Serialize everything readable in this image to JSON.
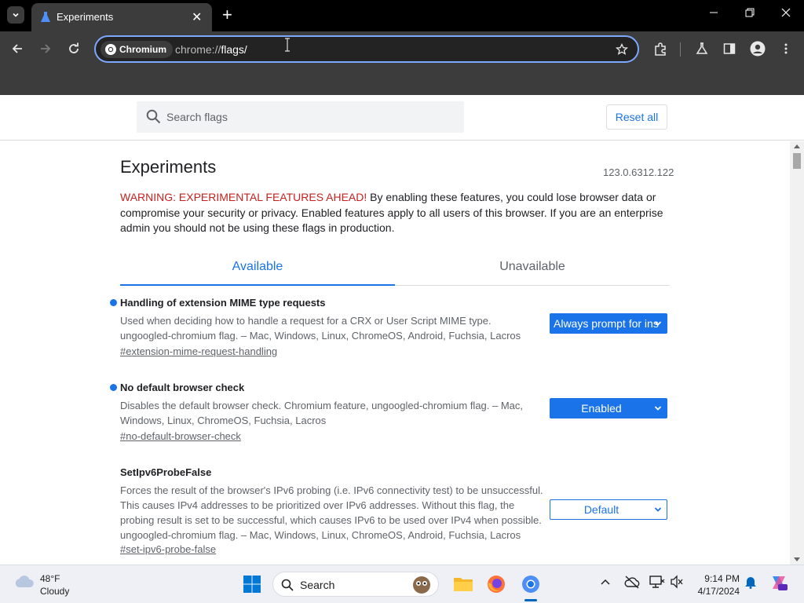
{
  "browser": {
    "tab_title": "Experiments",
    "chip_label": "Chromium",
    "url_host": "chrome://",
    "url_path": "flags/"
  },
  "search": {
    "placeholder": "Search flags",
    "reset_label": "Reset all"
  },
  "page": {
    "title": "Experiments",
    "version": "123.0.6312.122",
    "warning_prefix": "WARNING: EXPERIMENTAL FEATURES AHEAD!",
    "warning_body": " By enabling these features, you could lose browser data or compromise your security or privacy. Enabled features apply to all users of this browser. If you are an enterprise admin you should not be using these flags in production.",
    "tabs": {
      "available": "Available",
      "unavailable": "Unavailable"
    }
  },
  "flags": [
    {
      "name": "Handling of extension MIME type requests",
      "description": "Used when deciding how to handle a request for a CRX or User Script MIME type. ungoogled-chromium flag. – Mac, Windows, Linux, ChromeOS, Android, Fuchsia, Lacros",
      "link": "#extension-mime-request-handling",
      "value": "Always prompt for ins",
      "modified": true
    },
    {
      "name": "No default browser check",
      "description": "Disables the default browser check. Chromium feature, ungoogled-chromium flag. – Mac, Windows, Linux, ChromeOS, Fuchsia, Lacros",
      "link": "#no-default-browser-check",
      "value": "Enabled",
      "modified": true
    },
    {
      "name": "SetIpv6ProbeFalse",
      "description": "Forces the result of the browser's IPv6 probing (i.e. IPv6 connectivity test) to be unsuccessful. This causes IPv4 addresses to be prioritized over IPv6 addresses. Without this flag, the probing result is set to be successful, which causes IPv6 to be used over IPv4 when possible. ungoogled-chromium flag. – Mac, Windows, Linux, ChromeOS, Android, Fuchsia, Lacros",
      "link": "#set-ipv6-probe-false",
      "value": "Default",
      "modified": false
    }
  ],
  "taskbar": {
    "temp": "48°F",
    "condition": "Cloudy",
    "search_label": "Search",
    "time": "9:14 PM",
    "date": "4/17/2024"
  },
  "colors": {
    "accent": "#1a73e8",
    "warning": "#c5221f"
  }
}
